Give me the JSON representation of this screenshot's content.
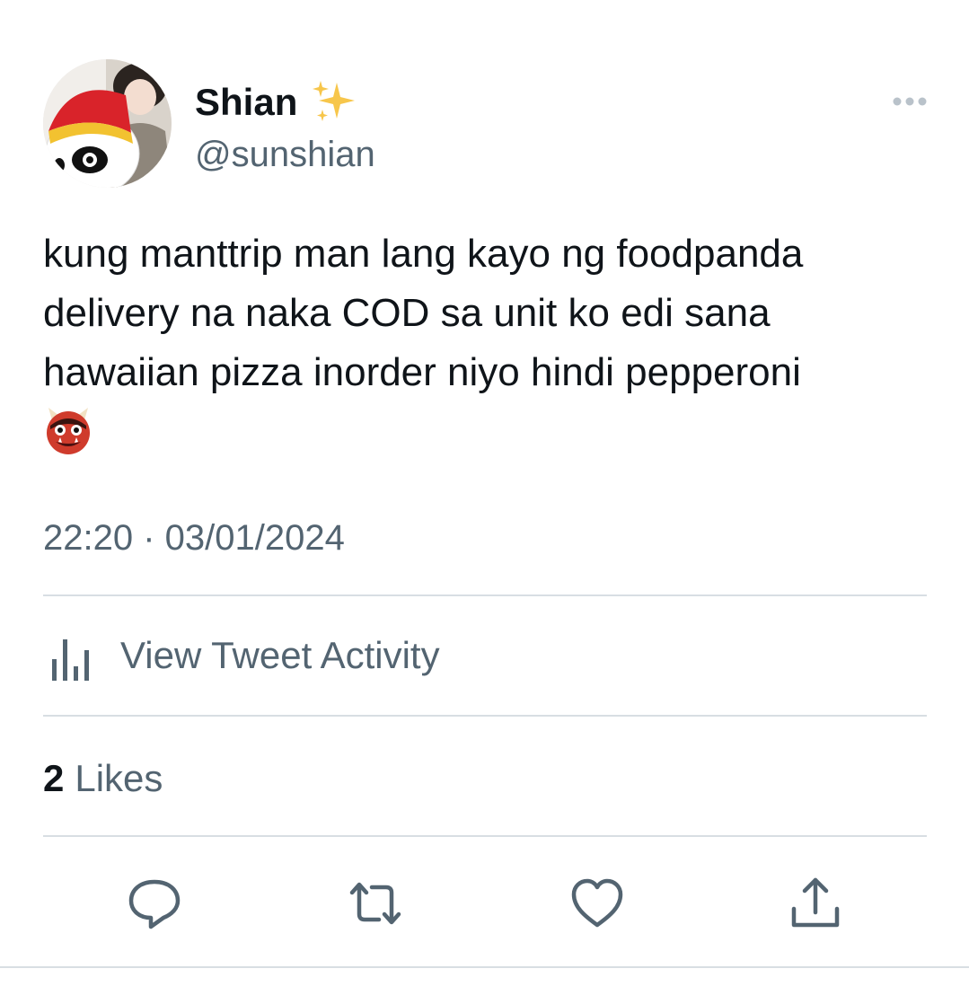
{
  "author": {
    "display_name": "Shian",
    "handle": "@sunshian",
    "name_emoji": "sparkles-icon"
  },
  "tweet": {
    "text": "kung manttrip man lang kayo ng foodpanda delivery na naka COD sa unit ko edi sana hawaiian pizza inorder niyo hindi pepperoni",
    "emoji": "ogre-icon",
    "timestamp": "22:20 · 03/01/2024"
  },
  "activity": {
    "label": "View Tweet Activity"
  },
  "likes": {
    "count": "2",
    "label": "Likes"
  },
  "actions": [
    "reply-icon",
    "retweet-icon",
    "like-icon",
    "share-icon"
  ],
  "colors": {
    "text_primary": "#0f1419",
    "text_secondary": "#536471",
    "divider": "#d8dee3",
    "icon": "#536471"
  }
}
